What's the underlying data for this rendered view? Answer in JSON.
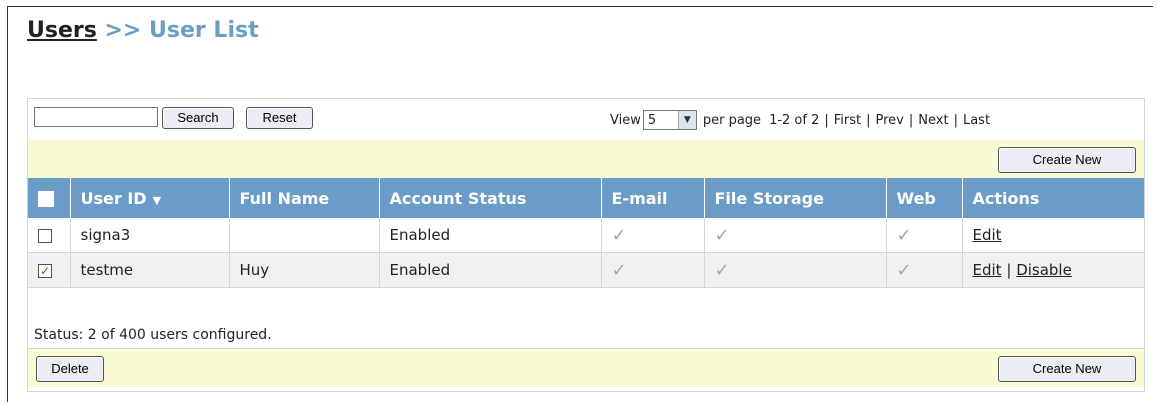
{
  "breadcrumb": {
    "parent": "Users",
    "separator": ">>",
    "current": "User List"
  },
  "toolbar": {
    "search_value": "",
    "search_label": "Search",
    "reset_label": "Reset",
    "view_label": "View",
    "view_value": "5",
    "per_page_label": "per page",
    "range_text": "1-2 of 2",
    "first_label": "First",
    "prev_label": "Prev",
    "next_label": "Next",
    "last_label": "Last",
    "pipe": "|"
  },
  "create_new_label": "Create New",
  "delete_label": "Delete",
  "table": {
    "columns": [
      "User ID",
      "Full Name",
      "Account Status",
      "E-mail",
      "File Storage",
      "Web",
      "Actions"
    ],
    "sort_indicator": "▼",
    "rows": [
      {
        "selected": false,
        "user_id": "signa3",
        "full_name": "",
        "status": "Enabled",
        "email": "✓",
        "file_storage": "✓",
        "web": "✓",
        "actions": [
          "Edit"
        ]
      },
      {
        "selected": true,
        "user_id": "testme",
        "full_name": "Huy",
        "status": "Enabled",
        "email": "✓",
        "file_storage": "✓",
        "web": "✓",
        "actions": [
          "Edit",
          "Disable"
        ]
      }
    ]
  },
  "status_text": "Status: 2 of 400 users configured.",
  "colors": {
    "header_bg": "#6b9cc8",
    "title_accent": "#6a9fc3",
    "bar_bg": "#fafad2"
  }
}
